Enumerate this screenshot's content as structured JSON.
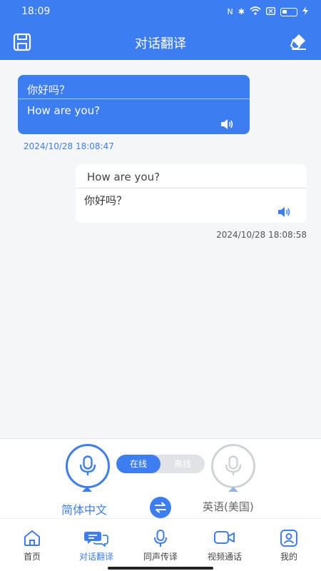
{
  "status": {
    "time": "18:09"
  },
  "app": {
    "title": "对话翻译"
  },
  "messages": [
    {
      "source": "你好吗？",
      "translation": "How are you?",
      "time": "2024/10/28 18:08:47"
    },
    {
      "source": "How are you?",
      "translation": "你好吗？",
      "time": "2024/10/28 18:08:58"
    }
  ],
  "controls": {
    "mode_online": "在线",
    "mode_offline": "离线",
    "lang_left": "简体中文",
    "lang_right": "英语(美国)"
  },
  "tabs": [
    {
      "label": "首页",
      "icon": "home-icon"
    },
    {
      "label": "对话翻译",
      "icon": "chat-icon",
      "active": true
    },
    {
      "label": "同声传译",
      "icon": "mic-icon"
    },
    {
      "label": "视频通话",
      "icon": "video-icon"
    },
    {
      "label": "我的",
      "icon": "profile-icon"
    }
  ],
  "colors": {
    "accent": "#3d7df2",
    "inactive": "#cfd3d8"
  }
}
